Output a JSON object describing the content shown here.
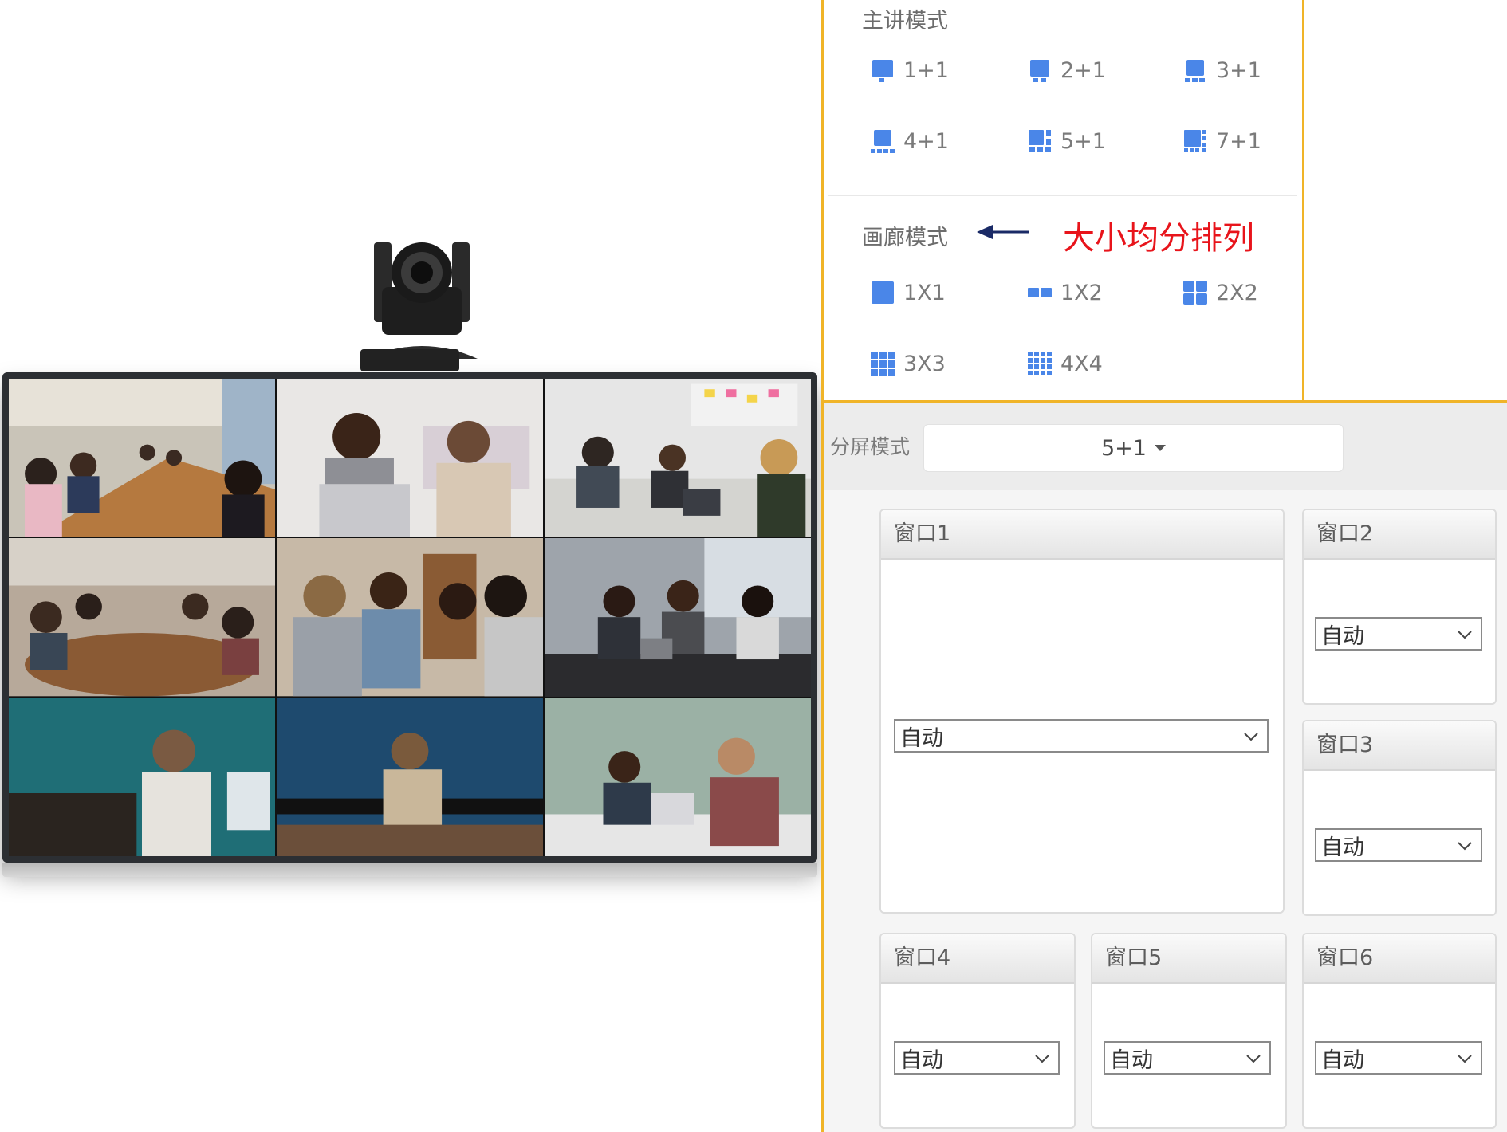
{
  "presenter_mode": {
    "title": "主讲模式",
    "options": [
      "1+1",
      "2+1",
      "3+1",
      "4+1",
      "5+1",
      "7+1"
    ]
  },
  "gallery_mode": {
    "title": "画廊模式",
    "note": "大小均分排列",
    "options": [
      "1X1",
      "1X2",
      "2X2",
      "3X3",
      "4X4"
    ]
  },
  "split_screen": {
    "label": "分屏模式",
    "selected": "5+1"
  },
  "windows": [
    {
      "title": "窗口1",
      "source": "自动"
    },
    {
      "title": "窗口2",
      "source": "自动"
    },
    {
      "title": "窗口3",
      "source": "自动"
    },
    {
      "title": "窗口4",
      "source": "自动"
    },
    {
      "title": "窗口5",
      "source": "自动"
    },
    {
      "title": "窗口6",
      "source": "自动"
    }
  ],
  "colors": {
    "accent_frame": "#f0b428",
    "icon_blue": "#4a86e8",
    "note_red": "#e8141b"
  }
}
